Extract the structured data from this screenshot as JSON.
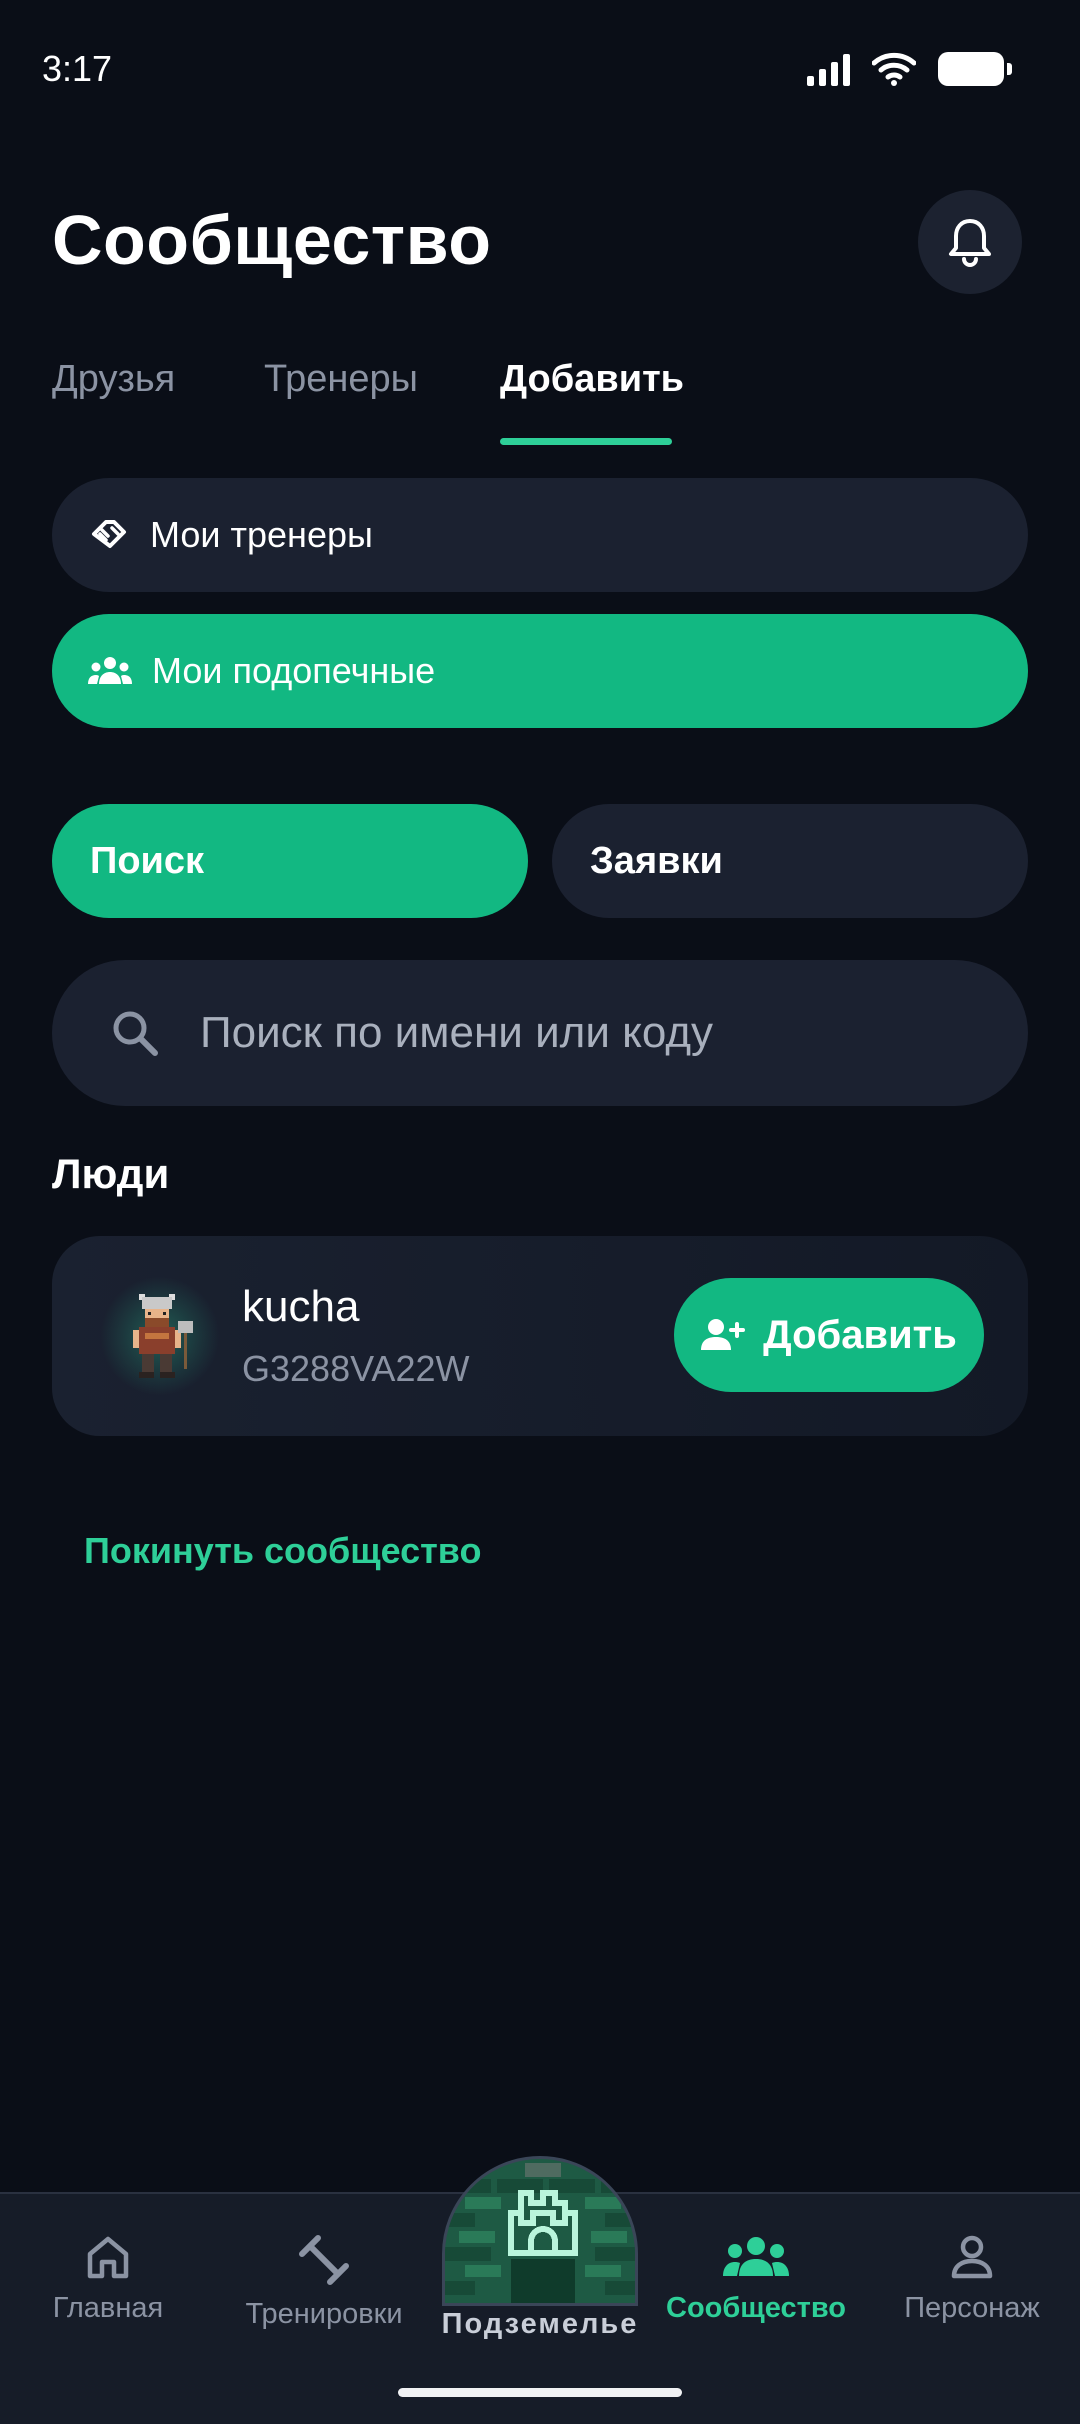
{
  "status_bar": {
    "time": "3:17"
  },
  "header": {
    "title": "Сообщество"
  },
  "tabs": [
    {
      "label": "Друзья"
    },
    {
      "label": "Тренеры"
    },
    {
      "label": "Добавить"
    }
  ],
  "menu": {
    "my_trainers": "Мои тренеры",
    "my_trainees": "Мои подопечные"
  },
  "segments": {
    "search": "Поиск",
    "requests": "Заявки"
  },
  "search": {
    "placeholder": "Поиск по имени или коду"
  },
  "people": {
    "section_title": "Люди",
    "items": [
      {
        "name": "kucha",
        "code": "G3288VA22W",
        "action": "Добавить"
      }
    ]
  },
  "leave_link": "Покинуть сообщество",
  "bottom_nav": {
    "items": [
      {
        "label": "Главная",
        "icon": "home-icon"
      },
      {
        "label": "Тренировки",
        "icon": "dumbbell-icon"
      },
      {
        "label": "Подземелье",
        "icon": "castle-icon"
      },
      {
        "label": "Сообщество",
        "icon": "people-icon"
      },
      {
        "label": "Персонаж",
        "icon": "person-icon"
      }
    ],
    "active": "Сообщество"
  },
  "colors": {
    "background": "#0a0e17",
    "surface": "#1b2130",
    "accent": "#12b882",
    "accent_text": "#2ecf98",
    "muted_text": "#8b93a3"
  }
}
